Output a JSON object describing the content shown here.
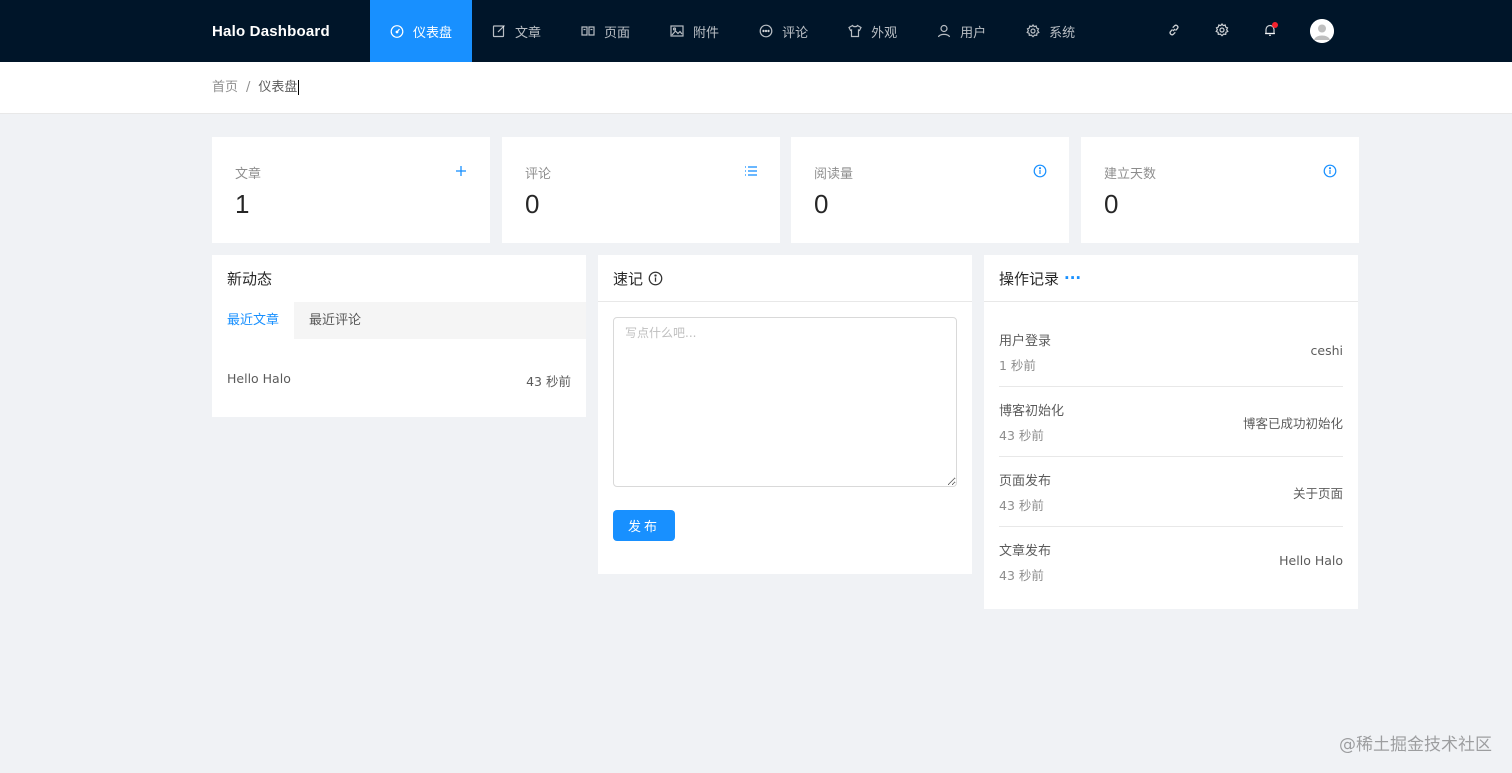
{
  "brand": "Halo  Dashboard",
  "nav": [
    {
      "label": "仪表盘",
      "icon": "dashboard-icon",
      "active": true
    },
    {
      "label": "文章",
      "icon": "edit-icon"
    },
    {
      "label": "页面",
      "icon": "book-icon"
    },
    {
      "label": "附件",
      "icon": "picture-icon"
    },
    {
      "label": "评论",
      "icon": "message-icon"
    },
    {
      "label": "外观",
      "icon": "skin-icon"
    },
    {
      "label": "用户",
      "icon": "user-icon"
    },
    {
      "label": "系统",
      "icon": "setting-icon"
    }
  ],
  "toolbar": {
    "icons": [
      "link-icon",
      "gear-icon",
      "bell-icon",
      "avatar"
    ]
  },
  "breadcrumb": {
    "home": "首页",
    "separator": "/",
    "current": "仪表盘"
  },
  "stats": [
    {
      "label": "文章",
      "value": "1",
      "icon": "plus-icon"
    },
    {
      "label": "评论",
      "value": "0",
      "icon": "list-icon"
    },
    {
      "label": "阅读量",
      "value": "0",
      "icon": "info-icon"
    },
    {
      "label": "建立天数",
      "value": "0",
      "icon": "info-icon"
    }
  ],
  "activity": {
    "title": "新动态",
    "tabs": [
      "最近文章",
      "最近评论"
    ],
    "posts": [
      {
        "title": "Hello Halo",
        "time": "43 秒前"
      }
    ]
  },
  "memo": {
    "title": "速记",
    "placeholder": "写点什么吧...",
    "submit": "发布"
  },
  "logs": {
    "title": "操作记录",
    "more": "···",
    "items": [
      {
        "title": "用户登录",
        "time": "1 秒前",
        "content": "ceshi"
      },
      {
        "title": "博客初始化",
        "time": "43 秒前",
        "content": "博客已成功初始化"
      },
      {
        "title": "页面发布",
        "time": "43 秒前",
        "content": "关于页面"
      },
      {
        "title": "文章发布",
        "time": "43 秒前",
        "content": "Hello Halo"
      }
    ]
  },
  "watermark": "@稀土掘金技术社区",
  "colors": {
    "header": "#001529",
    "primary": "#1890ff",
    "background": "#f0f2f5",
    "notification_dot": "#f5222d"
  }
}
